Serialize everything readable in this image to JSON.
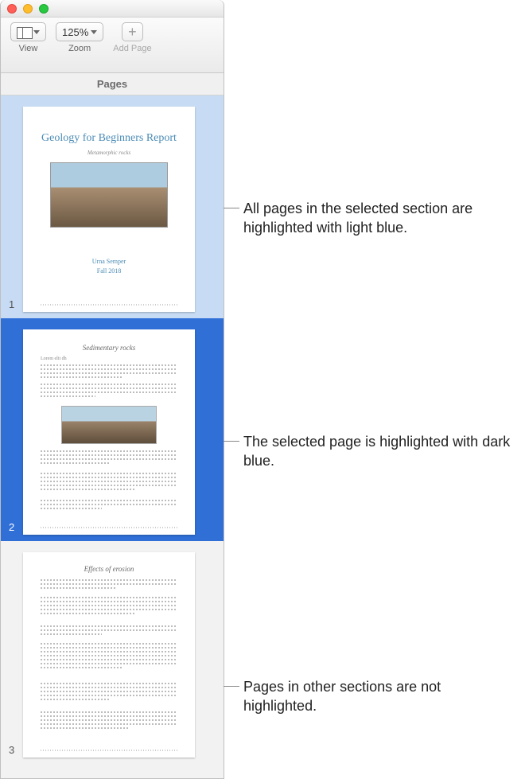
{
  "toolbar": {
    "view_label": "View",
    "zoom_label": "Zoom",
    "zoom_value": "125%",
    "add_page_label": "Add Page"
  },
  "sidebar": {
    "header": "Pages",
    "pages": [
      {
        "number": "1",
        "title": "Geology for Beginners Report",
        "subtitle": "Metamorphic rocks",
        "author": "Urna Semper",
        "date": "Fall 2018"
      },
      {
        "number": "2",
        "section_title": "Sedimentary rocks",
        "subheading": "Lorem elit dh"
      },
      {
        "number": "3",
        "section_title": "Effects of erosion"
      }
    ]
  },
  "annotations": {
    "a1": "All pages in the selected section are highlighted with light blue.",
    "a2": "The selected page is highlighted with dark blue.",
    "a3": "Pages in other sections are not highlighted."
  }
}
